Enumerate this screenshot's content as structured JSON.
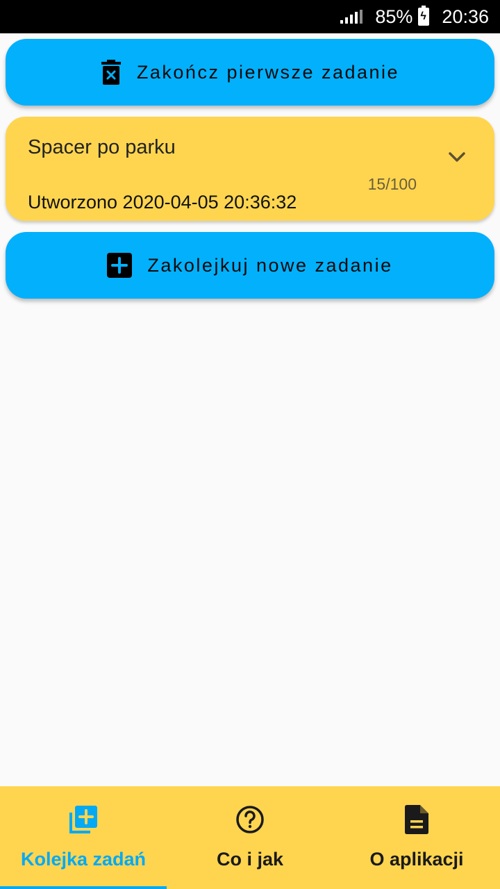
{
  "status_bar": {
    "battery_percent": "85%",
    "time": "20:36"
  },
  "actions": {
    "finish_first_label": "Zakończ pierwsze zadanie",
    "enqueue_new_label": "Zakolejkuj nowe zadanie"
  },
  "task": {
    "title": "Spacer po parku",
    "progress": "15/100",
    "created": "Utworzono 2020-04-05 20:36:32"
  },
  "bottom_nav": {
    "items": [
      {
        "label": "Kolejka zadań",
        "icon": "queue-add-icon",
        "active": true
      },
      {
        "label": "Co i jak",
        "icon": "help-circle-icon",
        "active": false
      },
      {
        "label": "O aplikacji",
        "icon": "document-icon",
        "active": false
      }
    ]
  },
  "colors": {
    "accent_blue": "#03b0fc",
    "card_yellow": "#ffd54f",
    "background": "#fafafa"
  }
}
